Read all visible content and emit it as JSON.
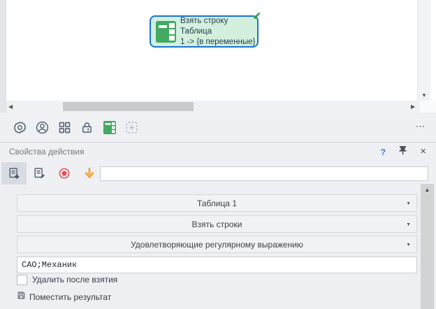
{
  "canvas": {
    "node": {
      "title_line1": "Взять строку Таблица",
      "title_line2": "1 -> {в переменные}",
      "status": "valid",
      "fill_color": "#d2f0dd",
      "border_color": "#1a73d1",
      "icon": "table-icon",
      "status_icon": "check-icon"
    }
  },
  "node_toolbar": {
    "buttons": [
      "settings",
      "user",
      "apps-grid",
      "lock",
      "table",
      "capture-region"
    ],
    "more_label": "⋯"
  },
  "properties": {
    "title": "Свойства действия",
    "header_icons": [
      "help-icon",
      "pin-icon",
      "close-icon"
    ],
    "help_label": "?",
    "close_label": "×",
    "toolbar_buttons": [
      "action-properties",
      "edit-description",
      "record",
      "import-down"
    ],
    "filter_value": "",
    "fields": {
      "table": "Таблица 1",
      "action": "Взять строки",
      "condition": "Удовлетворяющие регулярному выражению",
      "regex": "САО;Механик",
      "delete_after_label": "Удалить после взятия",
      "delete_after_checked": false,
      "place_result_label": "Поместить результат"
    }
  },
  "icons": {
    "caret": "▼",
    "check": "✔",
    "scroll_up": "▲",
    "scroll_down": "▼",
    "scroll_left": "◀",
    "scroll_right": "▶"
  },
  "colors": {
    "accent_blue": "#1a73d1",
    "node_green_fill": "#d2f0dd",
    "icon_green": "#44a961",
    "record_red": "#e94b4e",
    "arrow_orange": "#f0a63c",
    "help_blue": "#4c7fd2",
    "panel_bg": "#eef0f4"
  }
}
